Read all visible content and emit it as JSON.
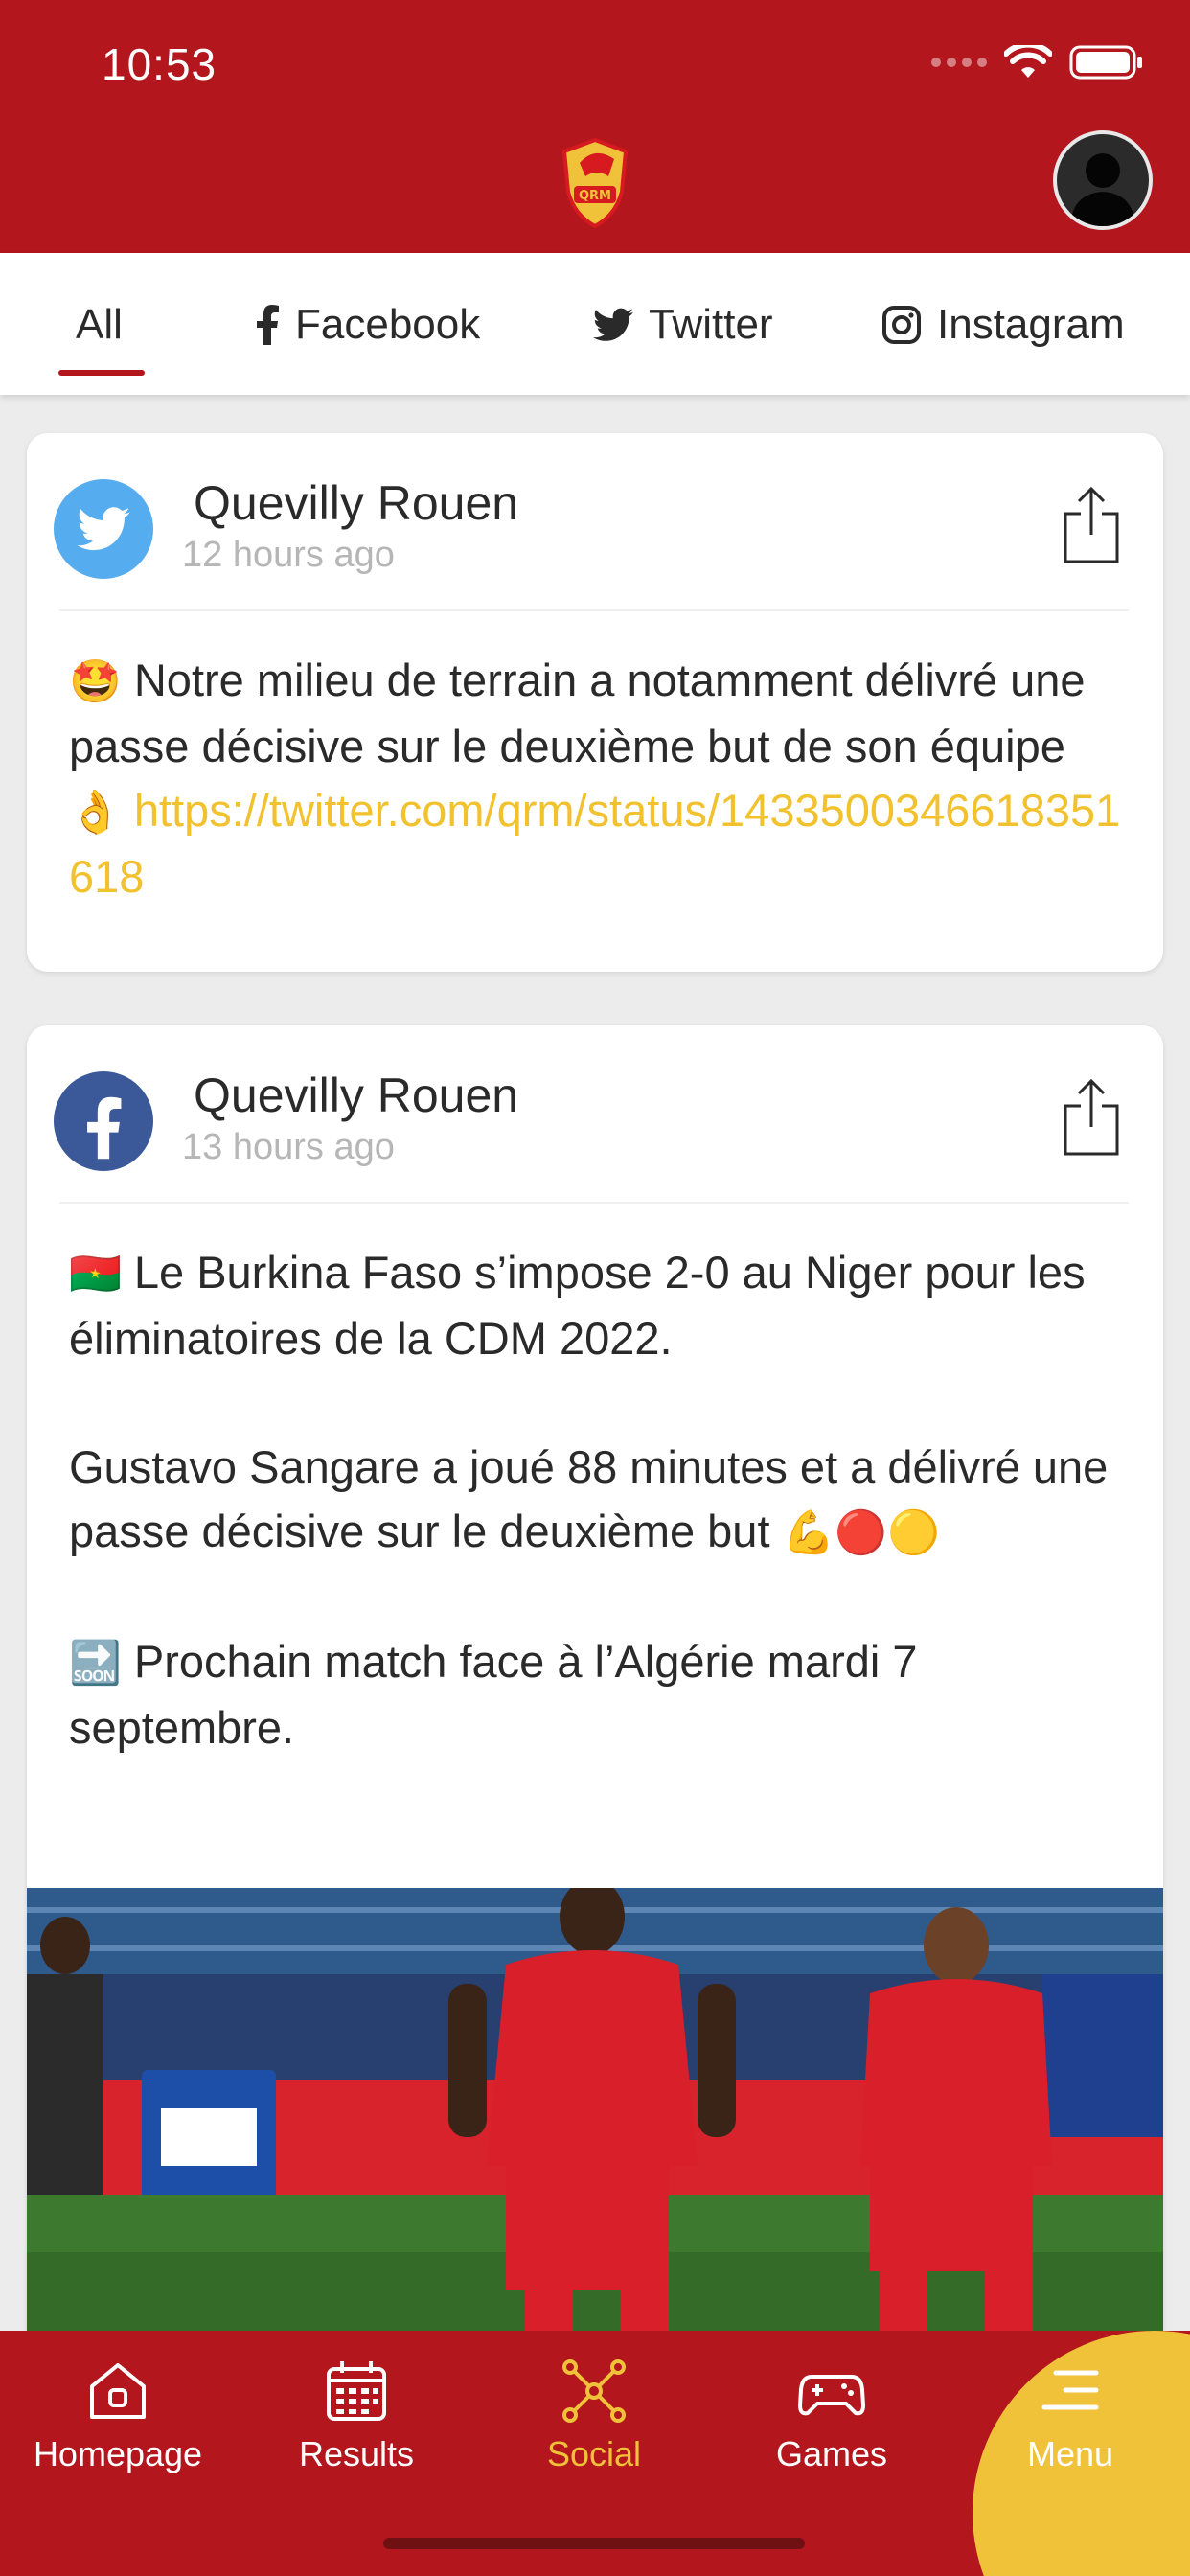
{
  "status_bar": {
    "time": "10:53"
  },
  "tabs": [
    {
      "label": "All",
      "icon": "none",
      "active": true
    },
    {
      "label": "Facebook",
      "icon": "facebook-icon"
    },
    {
      "label": "Twitter",
      "icon": "twitter-icon"
    },
    {
      "label": "Instagram",
      "icon": "instagram-icon"
    }
  ],
  "posts": [
    {
      "source": "twitter",
      "author": "Quevilly Rouen",
      "time": "12 hours ago",
      "text_emoji": "🤩",
      "text": "Notre milieu de terrain a notamment délivré une passe décisive sur le deuxième but de son équipe",
      "text_emoji_end": "👌",
      "link": "https://twitter.com/qrm/status/1433500346618351618"
    },
    {
      "source": "facebook",
      "author": "Quevilly Rouen",
      "time": "13 hours ago",
      "para1_emoji": "🇧🇫",
      "para1": "Le Burkina Faso s’impose 2-0 au Niger pour les éliminatoires de la CDM 2022.",
      "para2": "Gustavo Sangare a joué 88 minutes et a délivré une passe décisive sur le deuxième but",
      "para2_emojis": "💪🔴🟡",
      "para3_emoji": "🔜",
      "para3": "Prochain match face à l’Algérie mardi 7 septembre."
    }
  ],
  "bottom_nav": [
    {
      "label": "Homepage",
      "icon": "home-icon"
    },
    {
      "label": "Results",
      "icon": "calendar-icon"
    },
    {
      "label": "Social",
      "icon": "social-network-icon",
      "active": true
    },
    {
      "label": "Games",
      "icon": "gamepad-icon"
    },
    {
      "label": "Menu",
      "icon": "menu-icon"
    }
  ],
  "colors": {
    "brand_red": "#b3161d",
    "accent_yellow": "#f0c23a",
    "link_yellow": "#f2c12e",
    "twitter_blue": "#55acee",
    "facebook_blue": "#3b5998"
  }
}
